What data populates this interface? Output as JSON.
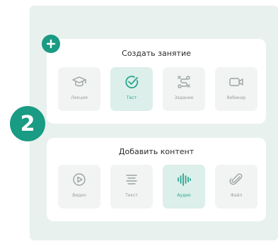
{
  "step_number": "2",
  "create_lesson": {
    "title": "Создать занятие",
    "items": [
      {
        "label": "Лекция",
        "icon": "graduation-cap-icon",
        "active": false
      },
      {
        "label": "Тест",
        "icon": "check-circle-icon",
        "active": true
      },
      {
        "label": "Задание",
        "icon": "route-icon",
        "active": false
      },
      {
        "label": "Вебинар",
        "icon": "video-camera-icon",
        "active": false
      }
    ]
  },
  "add_content": {
    "title": "Добавить контент",
    "items": [
      {
        "label": "Видео",
        "icon": "play-circle-icon",
        "active": false
      },
      {
        "label": "Текст",
        "icon": "text-lines-icon",
        "active": false
      },
      {
        "label": "Аудио",
        "icon": "audio-wave-icon",
        "active": true
      },
      {
        "label": "Файл",
        "icon": "paperclip-icon",
        "active": false
      }
    ]
  },
  "colors": {
    "accent": "#1a9b83",
    "panel_bg": "#e8f1ee",
    "tile_bg": "#f2f4f3",
    "tile_active_bg": "#dcefea"
  }
}
